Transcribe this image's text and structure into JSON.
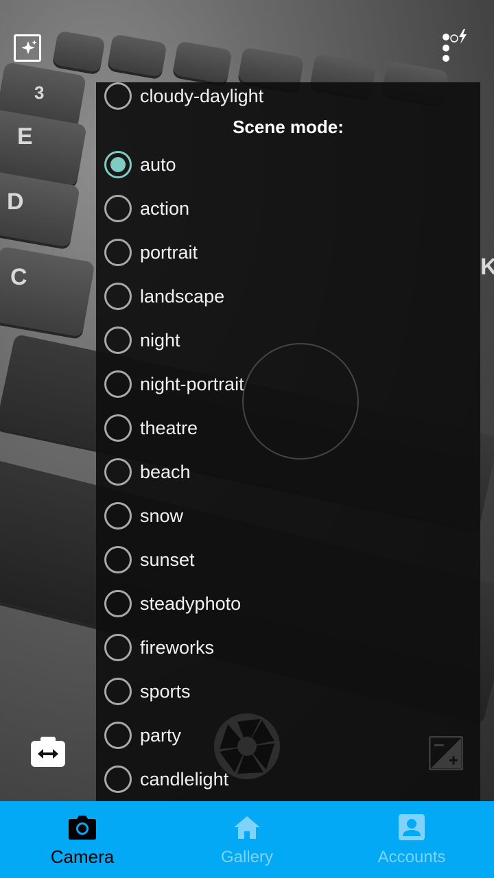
{
  "popup": {
    "previous_item": "cloudy-daylight",
    "section_title": "Scene mode:",
    "selected": "auto",
    "options": [
      "auto",
      "action",
      "portrait",
      "landscape",
      "night",
      "night-portrait",
      "theatre",
      "beach",
      "snow",
      "sunset",
      "steadyphoto",
      "fireworks",
      "sports",
      "party",
      "candlelight"
    ]
  },
  "bottom_nav": {
    "items": [
      {
        "label": "Camera",
        "icon": "camera-icon",
        "active": true
      },
      {
        "label": "Gallery",
        "icon": "home-icon",
        "active": false
      },
      {
        "label": "Accounts",
        "icon": "account-icon",
        "active": false
      }
    ]
  },
  "icons": {
    "top_left": "auto-enhance-icon",
    "top_right": "settings-flash-icon",
    "switch_camera": "switch-camera-icon",
    "shutter": "shutter-icon",
    "exposure": "exposure-icon"
  },
  "colors": {
    "accent_radio": "#80cbc4",
    "nav_bar": "#03a9f4",
    "nav_inactive_text": "#7fd3fb",
    "popup_bg": "#0f0f0f"
  }
}
